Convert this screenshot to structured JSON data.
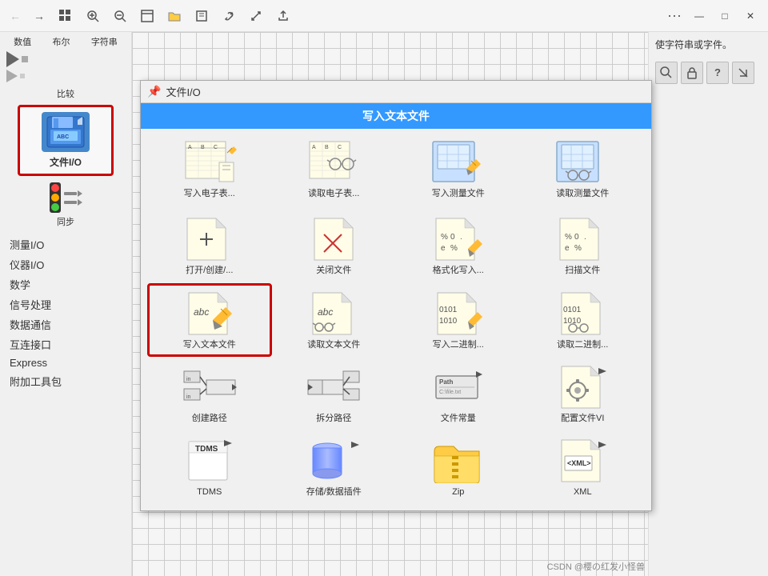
{
  "titlebar": {
    "dots": "···",
    "minimize": "—",
    "maximize": "□",
    "close": "✕"
  },
  "sidebar": {
    "categories": [
      "数值",
      "布尔",
      "字符串"
    ],
    "compare_label": "比较",
    "fileio_label": "文件I/O",
    "sync_label": "同步",
    "menu_items": [
      "测量I/O",
      "仪器I/O",
      "数学",
      "信号处理",
      "数据通信",
      "互连接口",
      "Express",
      "附加工具包"
    ]
  },
  "popup": {
    "header": "文件I/O",
    "title": "写入文本文件",
    "items": [
      {
        "id": "write-spreadsheet",
        "label": "写入电子表...",
        "highlighted": false
      },
      {
        "id": "read-spreadsheet",
        "label": "读取电子表...",
        "highlighted": false
      },
      {
        "id": "write-measure",
        "label": "写入测量文件",
        "highlighted": false
      },
      {
        "id": "read-measure",
        "label": "读取测量文件",
        "highlighted": false
      },
      {
        "id": "open-file",
        "label": "打开/创建/...",
        "highlighted": false
      },
      {
        "id": "close-file",
        "label": "关闭文件",
        "highlighted": false
      },
      {
        "id": "format-write",
        "label": "格式化写入...",
        "highlighted": false
      },
      {
        "id": "scan-file",
        "label": "扫描文件",
        "highlighted": false
      },
      {
        "id": "write-text",
        "label": "写入文本文件",
        "highlighted": true
      },
      {
        "id": "read-text",
        "label": "读取文本文件",
        "highlighted": false
      },
      {
        "id": "write-binary",
        "label": "写入二进制...",
        "highlighted": false
      },
      {
        "id": "read-binary",
        "label": "读取二进制...",
        "highlighted": false
      },
      {
        "id": "create-path",
        "label": "创建路径",
        "highlighted": false
      },
      {
        "id": "split-path",
        "label": "拆分路径",
        "highlighted": false
      },
      {
        "id": "file-const",
        "label": "文件常量",
        "highlighted": false
      },
      {
        "id": "config-vi",
        "label": "配置文件VI",
        "highlighted": false
      },
      {
        "id": "tdms",
        "label": "TDMS",
        "highlighted": false
      },
      {
        "id": "storage",
        "label": "存储/数据插件",
        "highlighted": false
      },
      {
        "id": "zip",
        "label": "Zip",
        "highlighted": false
      },
      {
        "id": "xml",
        "label": "XML",
        "highlighted": false
      }
    ]
  },
  "right_panel": {
    "description": "使字符串或字件。",
    "tools": [
      "🔍",
      "🔒",
      "?"
    ]
  },
  "watermark": "CSDN @樱の红发小怪兽"
}
